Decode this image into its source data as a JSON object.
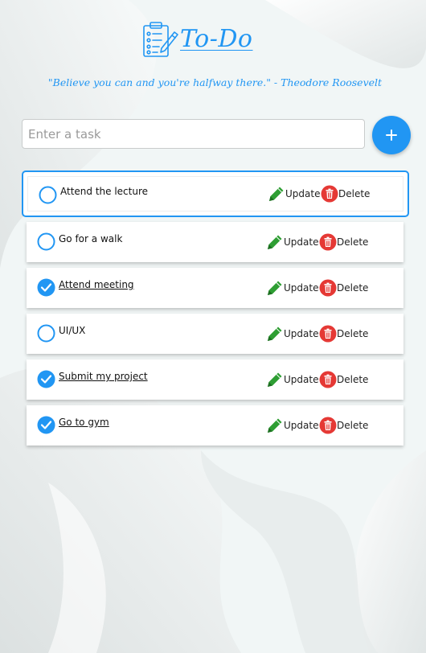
{
  "header": {
    "title": "To-Do",
    "quote": "\"Believe you can and you're halfway there.\" - Theodore Roosevelt"
  },
  "input": {
    "placeholder": "Enter a task",
    "value": ""
  },
  "add_button": {
    "icon": "plus-icon"
  },
  "tasks": [
    {
      "text": "Attend the lecture",
      "done": false
    },
    {
      "text": "Go for a walk",
      "done": false
    },
    {
      "text": "Attend meeting",
      "done": true
    },
    {
      "text": "UI/UX",
      "done": false
    },
    {
      "text": "Submit my project",
      "done": true
    },
    {
      "text": "Go to gym",
      "done": true
    }
  ],
  "actions": {
    "update_label": "Update",
    "delete_label": "Delete"
  },
  "colors": {
    "accent": "#2196f3",
    "update_green": "#2e9e33",
    "delete_red": "#e53935"
  }
}
